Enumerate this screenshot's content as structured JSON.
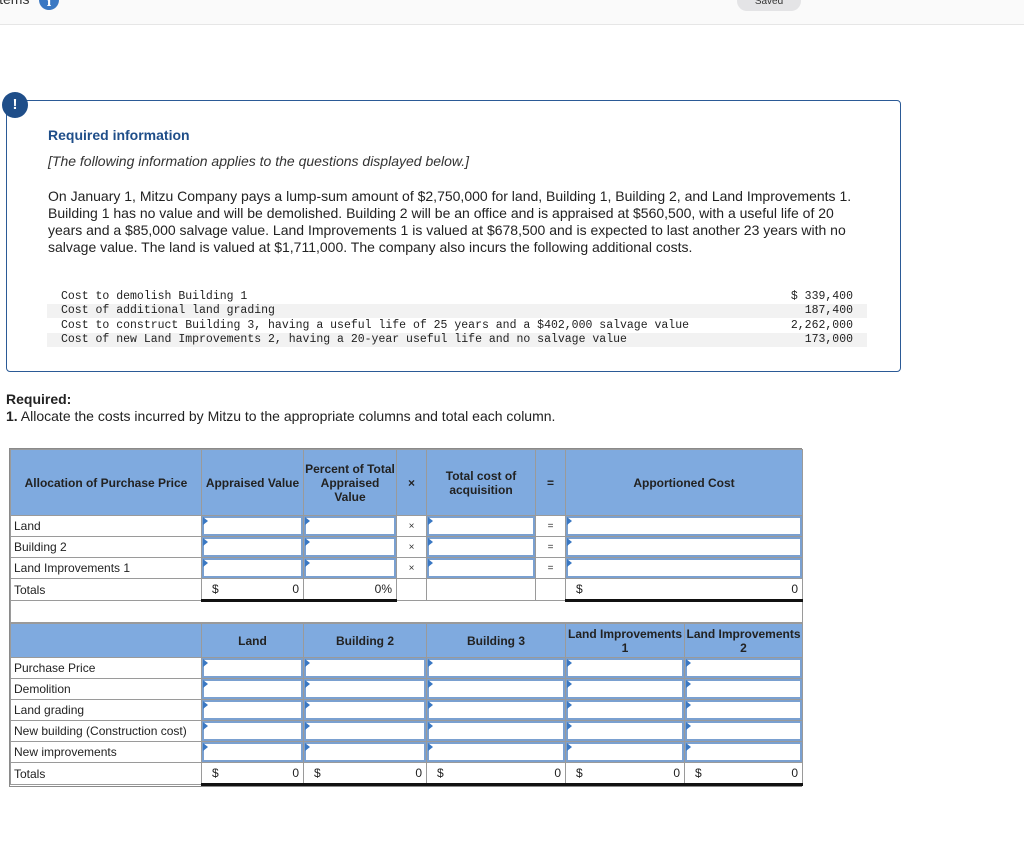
{
  "topbar": {
    "items_label": "items",
    "info_icon": "info-icon",
    "saved_label": "Saved"
  },
  "info": {
    "alert_icon": "!",
    "title": "Required information",
    "subtitle": "[The following information applies to the questions displayed below.]",
    "paragraph": "On January 1, Mitzu Company pays a lump-sum amount of $2,750,000 for land, Building 1, Building 2, and Land Improvements 1. Building 1 has no value and will be demolished. Building 2 will be an office and is appraised at $560,500, with a useful life of 20 years and a $85,000 salvage value. Land Improvements 1 is valued at $678,500 and is expected to last another 23 years with no salvage value. The land is valued at $1,711,000. The company also incurs the following additional costs.",
    "costs": [
      {
        "label": "Cost to demolish Building 1",
        "amount": "$ 339,400"
      },
      {
        "label": "Cost of additional land grading",
        "amount": "187,400"
      },
      {
        "label": "Cost to construct Building 3, having a useful life of 25 years and a $402,000 salvage value",
        "amount": "2,262,000"
      },
      {
        "label": "Cost of new Land Improvements 2, having a 20-year useful life and no salvage value",
        "amount": "173,000"
      }
    ]
  },
  "required": {
    "title": "Required:",
    "number": "1.",
    "text": " Allocate the costs incurred by Mitzu to the appropriate columns and total each column."
  },
  "allocation": {
    "headers": {
      "label": "Allocation of Purchase Price",
      "appraised": "Appraised Value",
      "percent": "Percent of Total Appraised Value",
      "times": "×",
      "total_cost": "Total cost of acquisition",
      "equals": "=",
      "apportioned": "Apportioned Cost"
    },
    "rows": [
      {
        "label": "Land",
        "appraised": "",
        "percent": "",
        "times": "×",
        "total_cost": "",
        "equals": "=",
        "apportioned": ""
      },
      {
        "label": "Building 2",
        "appraised": "",
        "percent": "",
        "times": "×",
        "total_cost": "",
        "equals": "=",
        "apportioned": ""
      },
      {
        "label": "Land Improvements 1",
        "appraised": "",
        "percent": "",
        "times": "×",
        "total_cost": "",
        "equals": "=",
        "apportioned": ""
      }
    ],
    "totals": {
      "label": "Totals",
      "appraised_currency": "$",
      "appraised_value": "0",
      "percent_value": "0%",
      "apportioned_currency": "$",
      "apportioned_value": "0"
    }
  },
  "costs_table": {
    "headers": [
      "Land",
      "Building 2",
      "Building 3",
      "Land Improvements 1",
      "Land Improvements 2"
    ],
    "rows": [
      {
        "label": "Purchase Price"
      },
      {
        "label": "Demolition"
      },
      {
        "label": "Land grading"
      },
      {
        "label": "New building (Construction cost)"
      },
      {
        "label": "New improvements"
      }
    ],
    "totals": {
      "label": "Totals",
      "currency": "$",
      "values": [
        "0",
        "0",
        "0",
        "0",
        "0"
      ]
    }
  }
}
